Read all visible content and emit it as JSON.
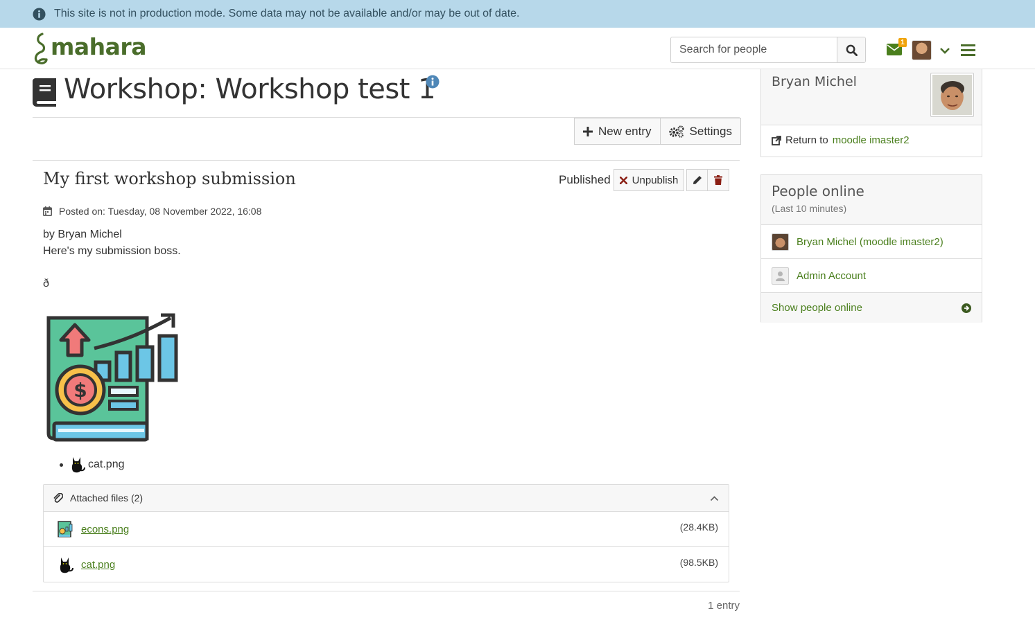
{
  "banner": {
    "text": "This site is not in production mode. Some data may not be available and/or may be out of date."
  },
  "header": {
    "logo_text": "mahara",
    "search_placeholder": "Search for people",
    "inbox_count": "1"
  },
  "page": {
    "title": "Workshop: Workshop test 1",
    "new_entry_label": "New entry",
    "settings_label": "Settings"
  },
  "post": {
    "title": "My first workshop submission",
    "status": "Published",
    "unpublish_label": "Unpublish",
    "posted_on": "Posted on: Tuesday, 08 November 2022, 16:08",
    "byline": "by Bryan Michel",
    "body": "Here's my submission boss.",
    "odd_char": "ð",
    "inline_file": "cat.png"
  },
  "attachments": {
    "heading": "Attached files (2)",
    "files": [
      {
        "name": "econs.png",
        "size": "(28.4KB)"
      },
      {
        "name": "cat.png",
        "size": "(98.5KB)"
      }
    ]
  },
  "entry_count": "1 entry",
  "sidebar": {
    "owner_name": "Bryan Michel",
    "return_prefix": "Return to",
    "return_link": "moodle imaster2",
    "online_title": "People online",
    "online_subtitle": "(Last 10 minutes)",
    "online_people": [
      {
        "name": "Bryan Michel (moodle imaster2)"
      },
      {
        "name": "Admin Account"
      }
    ],
    "show_online_label": "Show people online"
  },
  "colors": {
    "banner_bg": "#b7d8ea",
    "link": "#4a7f1d",
    "logo": "#4a6d2b",
    "badge": "#f0a30a"
  },
  "icons": [
    "info-icon",
    "search-icon",
    "envelope-icon",
    "chevron-down-icon",
    "hamburger-icon",
    "book-icon",
    "plus-icon",
    "gears-icon",
    "times-icon",
    "pencil-icon",
    "trash-icon",
    "calendar-icon",
    "paperclip-icon",
    "chevron-up-icon",
    "external-link-icon",
    "arrow-circle-right-icon"
  ]
}
